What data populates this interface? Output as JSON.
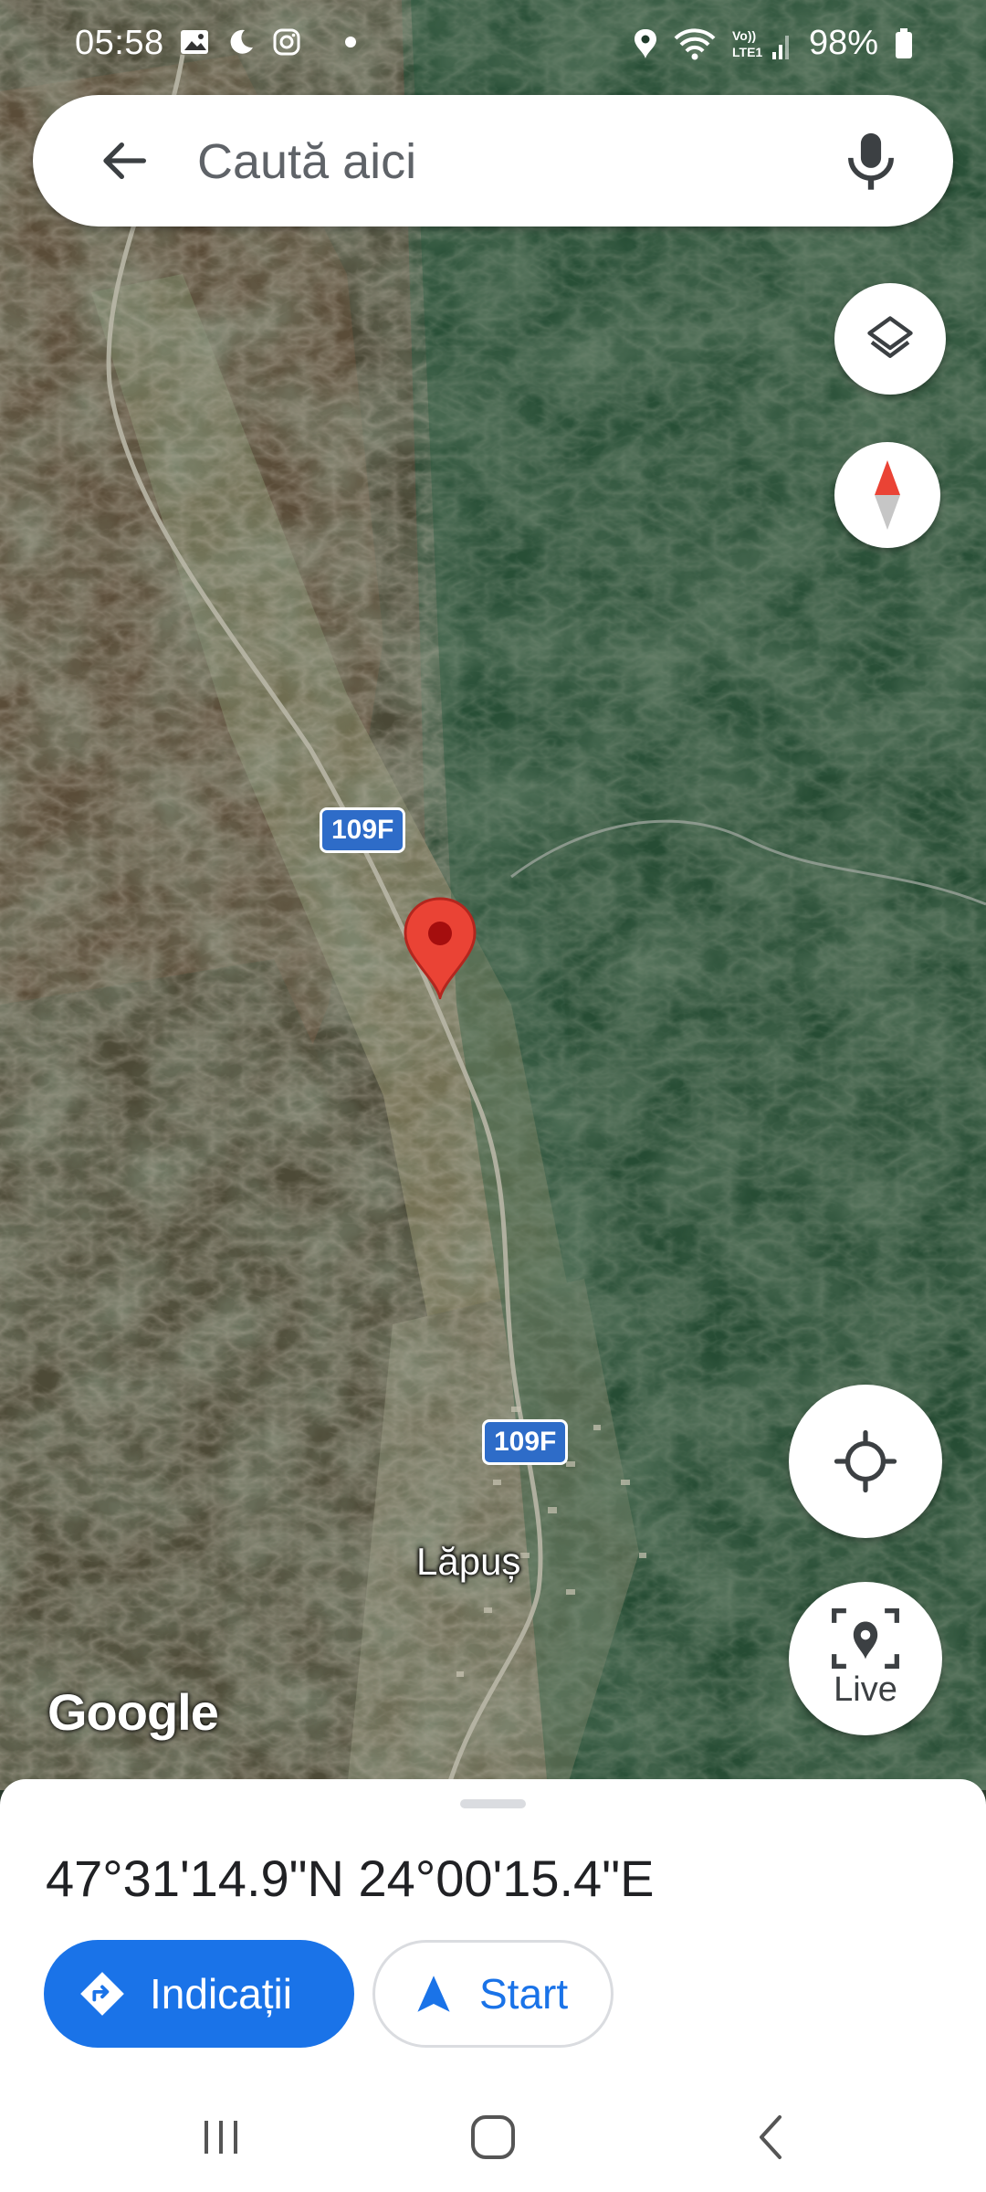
{
  "status_bar": {
    "time": "05:58",
    "left_icons": [
      "gallery-icon",
      "do-not-disturb-moon-icon",
      "instagram-icon",
      "dot-icon"
    ],
    "right_icons": [
      "location-icon",
      "wifi-icon",
      "volte-signal-icon",
      "battery-icon"
    ],
    "volte_label": "Vo)) LTE1",
    "battery": "98%"
  },
  "search": {
    "placeholder": "Caută aici",
    "back_icon": "arrow-back-icon",
    "mic_icon": "mic-icon"
  },
  "map": {
    "type": "satellite",
    "road_labels": [
      "109F",
      "109F"
    ],
    "town_label": "Lăpuș",
    "logo": "Google",
    "pin_color": "#ea4335"
  },
  "controls": {
    "layers_icon": "layers-icon",
    "compass_icon": "compass-icon",
    "my_location_icon": "my-location-icon",
    "live_label": "Live"
  },
  "place": {
    "coordinates": "47°31'14.9\"N 24°00'15.4\"E",
    "directions_label": "Indicații",
    "start_label": "Start"
  },
  "colors": {
    "accent": "#1a73e8",
    "pin": "#ea4335",
    "road_shield": "#2e6cc8"
  }
}
